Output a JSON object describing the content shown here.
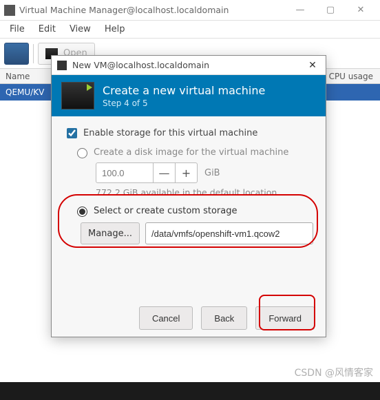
{
  "main_title": "Virtual Machine Manager@localhost.localdomain",
  "menu": {
    "file": "File",
    "edit": "Edit",
    "view": "View",
    "help": "Help"
  },
  "toolbar": {
    "open": "Open"
  },
  "list_header": {
    "name": "Name",
    "cpu": "CPU usage"
  },
  "vm_row": "QEMU/KV",
  "dialog": {
    "title": "New VM@localhost.localdomain",
    "heading": "Create a new virtual machine",
    "step": "Step 4 of 5",
    "enable_storage": "Enable storage for this virtual machine",
    "create_disk": "Create a disk image for the virtual machine",
    "size_value": "100.0",
    "size_unit": "GiB",
    "available": "772.2 GiB available in the default location",
    "custom_storage": "Select or create custom storage",
    "manage": "Manage...",
    "path": "/data/vmfs/openshift-vm1.qcow2",
    "cancel": "Cancel",
    "back": "Back",
    "forward": "Forward"
  },
  "watermark": "CSDN @风情客家",
  "min": "—",
  "plus": "+"
}
